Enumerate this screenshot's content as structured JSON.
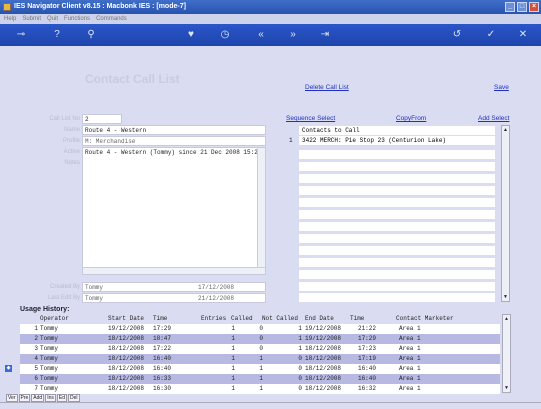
{
  "window": {
    "title": "IES Navigator Client v8.15 : Macbonk IES :     [mode-7]"
  },
  "menu": [
    "Help",
    "Submit",
    "Quit",
    "Functions",
    "Commands"
  ],
  "page": {
    "heading": "Contact Call List"
  },
  "links": {
    "delete": "Delete Call List",
    "save": "Save",
    "sequence": "Sequence Select",
    "copy": "CopyFrom",
    "add": "Add Select"
  },
  "form": {
    "call_list_no_label": "Call List No",
    "call_list_no": "2",
    "name_label": "Name",
    "name": "Route 4 - Western",
    "profile_label": "Profile",
    "profile": "M: Merchandise",
    "active_label": "Active",
    "notes_label": "Notes",
    "notes": "Route 4 - Western (Tommy) since 21 Dec 2008 15:23",
    "created_by_label": "Created By",
    "created_by": "Tommy",
    "created_date": "17/12/2008",
    "last_edit_label": "Last Edit By",
    "last_edit_by": "Tommy",
    "last_edit_date": "21/12/2008"
  },
  "contacts": {
    "header": "Contacts to Call",
    "rows": [
      {
        "num": "1",
        "text": "3422 MERCH: Pie Stop 23 (Centurion Lake)"
      }
    ]
  },
  "usage": {
    "title": "Usage History:",
    "columns": [
      "Operator",
      "Start Date",
      "Time",
      "Entries",
      "Called",
      "Not Called",
      "End Date",
      "Time",
      "Contact Marketer"
    ],
    "rows": [
      {
        "n": "1",
        "op": "Tommy",
        "sd": "19/12/2008",
        "st": "17:29",
        "en": "1",
        "ca": "0",
        "nc": "1",
        "ed": "19/12/2008",
        "et": "21:22",
        "cm": "Area 1"
      },
      {
        "n": "2",
        "op": "Tommy",
        "sd": "18/12/2008",
        "st": "18:47",
        "en": "1",
        "ca": "0",
        "nc": "1",
        "ed": "19/12/2008",
        "et": "17:29",
        "cm": "Area 1"
      },
      {
        "n": "3",
        "op": "Tommy",
        "sd": "18/12/2008",
        "st": "17:22",
        "en": "1",
        "ca": "0",
        "nc": "1",
        "ed": "18/12/2008",
        "et": "17:23",
        "cm": "Area 1"
      },
      {
        "n": "4",
        "op": "Tommy",
        "sd": "18/12/2008",
        "st": "16:40",
        "en": "1",
        "ca": "1",
        "nc": "0",
        "ed": "18/12/2008",
        "et": "17:19",
        "cm": "Area 1"
      },
      {
        "n": "5",
        "op": "Tommy",
        "sd": "18/12/2008",
        "st": "16:40",
        "en": "1",
        "ca": "1",
        "nc": "0",
        "ed": "18/12/2008",
        "et": "16:40",
        "cm": "Area 1"
      },
      {
        "n": "6",
        "op": "Tommy",
        "sd": "18/12/2008",
        "st": "16:33",
        "en": "1",
        "ca": "1",
        "nc": "0",
        "ed": "18/12/2008",
        "et": "16:40",
        "cm": "Area 1"
      },
      {
        "n": "7",
        "op": "Tommy",
        "sd": "18/12/2008",
        "st": "16:30",
        "en": "1",
        "ca": "1",
        "nc": "0",
        "ed": "18/12/2008",
        "et": "16:32",
        "cm": "Area 1"
      }
    ]
  },
  "status_buttons": [
    "Ver",
    "Pre",
    "Add",
    "Ins",
    "Ed",
    "Del"
  ],
  "toolbar_icons": [
    "key-icon",
    "help-icon",
    "search-icon",
    "heart-icon",
    "clock-icon",
    "rewind-icon",
    "fast-forward-icon",
    "end-icon",
    "back-icon",
    "check-icon",
    "close-icon"
  ],
  "colors": {
    "titlebar": "#2853b0",
    "panel": "#dadcf2",
    "row_highlight": "#b7b9e2",
    "link": "#2030c0"
  }
}
